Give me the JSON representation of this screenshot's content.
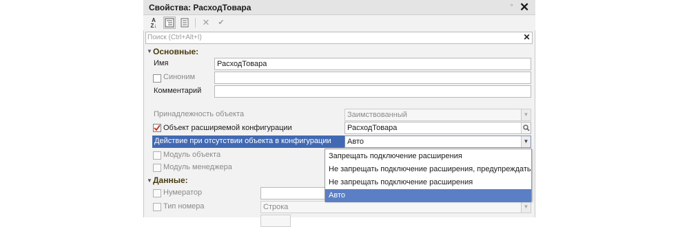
{
  "window": {
    "title": "Свойства: РасходТовара",
    "pin_icon": "pin-icon",
    "close_glyph": "✕"
  },
  "toolbar": {
    "sort_label": "A\nZ",
    "buttons": [
      "sort-alpha-icon",
      "categories-icon",
      "filter-icon",
      "clear-icon",
      "apply-icon"
    ]
  },
  "search": {
    "placeholder": "Поиск (Ctrl+Alt+I)",
    "value": "",
    "clear": "✕"
  },
  "basic": {
    "group_label": "Основные:",
    "name_label": "Имя",
    "name_value": "РасходТовара",
    "synonym_label": "Синоним",
    "synonym_value": "",
    "comment_label": "Комментарий",
    "comment_value": "",
    "ownership_label": "Принадлежность объекта",
    "ownership_value": "Заимствованный",
    "extended_object_label": "Объект расширяемой конфигурации",
    "extended_object_value": "РасходТовара",
    "extended_object_checked": true,
    "action_label": "Действие при отсутствии объекта в конфигурации",
    "action_value": "Авто",
    "object_module_label": "Модуль объекта",
    "manager_module_label": "Модуль менеджера"
  },
  "data": {
    "group_label": "Данные:",
    "numerator_label": "Нумератор",
    "numerator_value": "",
    "number_type_label": "Тип номера",
    "number_type_value": "Строка"
  },
  "dropdown": {
    "options": [
      "Запрещать подключение расширения",
      "Не запрещать подключение расширения, предупреждать",
      "Не запрещать подключение расширения",
      "Авто"
    ],
    "selected_index": 3
  },
  "colors": {
    "selection": "#4169b3",
    "menu_selection": "#5b7fc4",
    "group_label": "#4a3a10"
  }
}
